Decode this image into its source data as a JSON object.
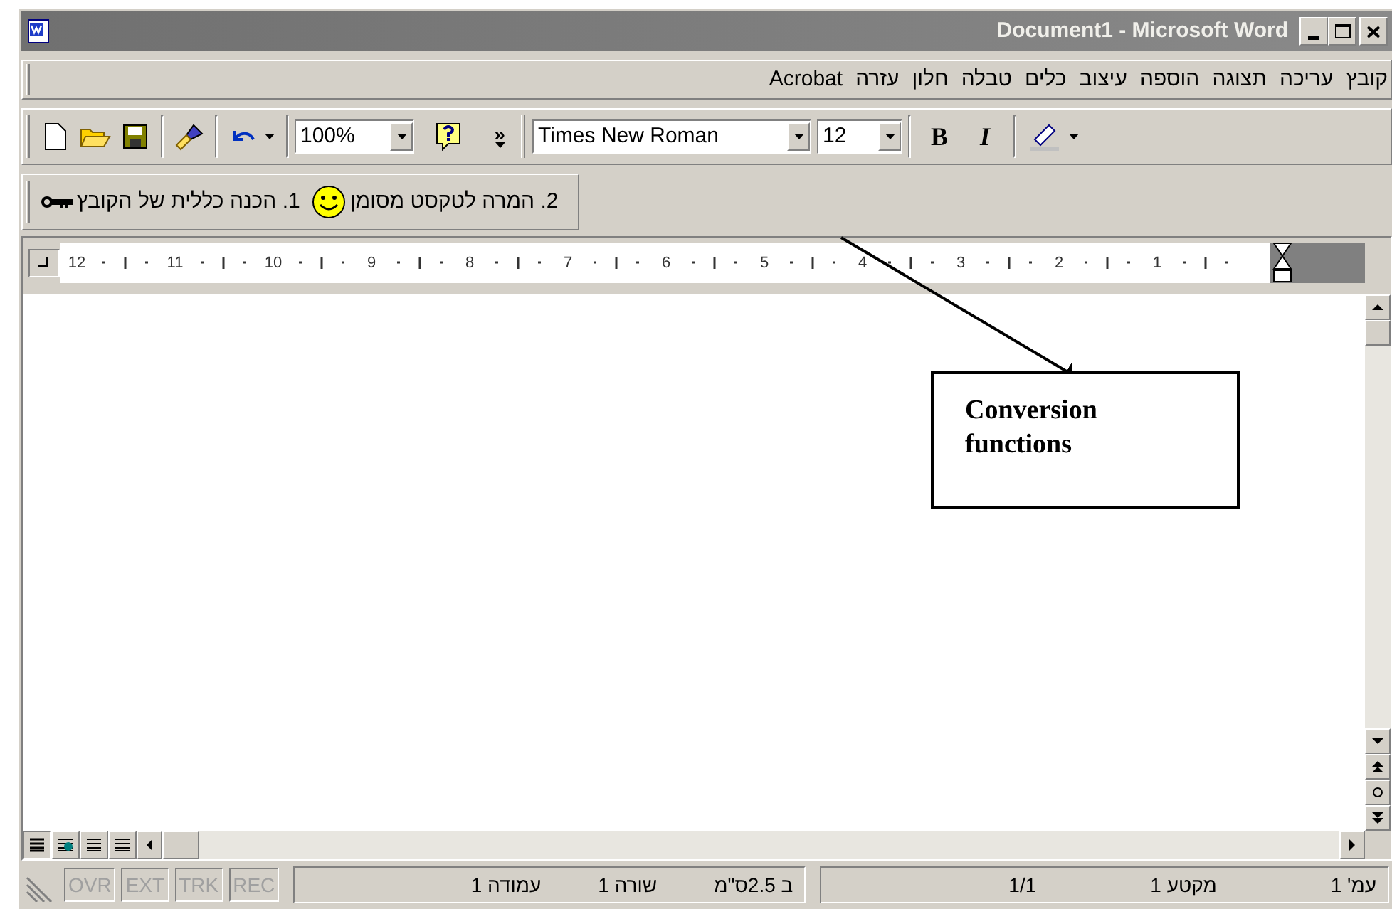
{
  "window": {
    "title": "Document1 - Microsoft Word",
    "active": false
  },
  "menu_bar": {
    "items": [
      "קובץ",
      "עריכה",
      "תצוגה",
      "הוספה",
      "עיצוב",
      "כלים",
      "טבלה",
      "חלון",
      "עזרה",
      "Acrobat"
    ]
  },
  "standard_toolbar": {
    "zoom": "100%",
    "more": "»",
    "font": "Times New Roman",
    "font_size": "12",
    "bold": "B",
    "italic": "I"
  },
  "custom_toolbar": {
    "buttons": [
      {
        "kind": "smiley",
        "label": "2. המרה לטקסט מסומן"
      },
      {
        "kind": "key",
        "label": "1. הכנה כללית של הקובץ"
      }
    ]
  },
  "ruler": {
    "numbers": [
      "1",
      "2",
      "3",
      "4",
      "5",
      "6",
      "7",
      "8",
      "9",
      "10",
      "11",
      "12"
    ]
  },
  "callout": {
    "lines": [
      "Conversion",
      "functions"
    ]
  },
  "status_bar": {
    "page": [
      "עמ' 1",
      "מקטע 1",
      "1/1"
    ],
    "position": [
      "ב 2.5ס\"מ",
      "שורה 1",
      "עמודה 1"
    ],
    "modes": [
      {
        "label": "REC",
        "disabled": true
      },
      {
        "label": "TRK",
        "disabled": true
      },
      {
        "label": "EXT",
        "disabled": true
      },
      {
        "label": "OVR",
        "disabled": true
      }
    ]
  }
}
